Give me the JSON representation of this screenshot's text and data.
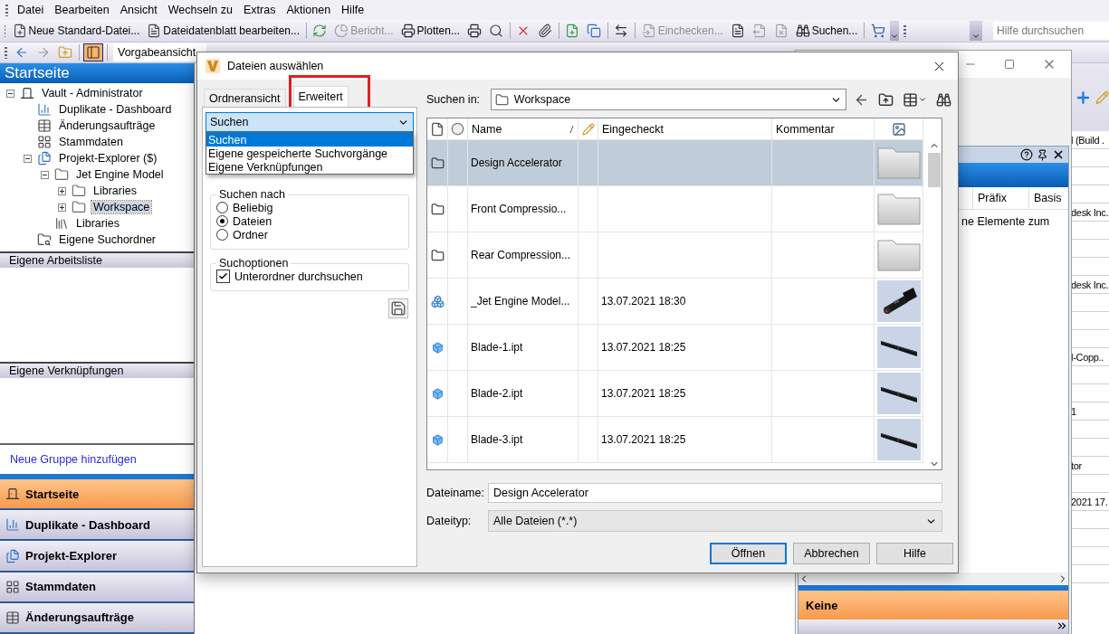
{
  "menu": [
    "Datei",
    "Bearbeiten",
    "Ansicht",
    "Wechseln zu",
    "Extras",
    "Aktionen",
    "Hilfe"
  ],
  "toolbar": [
    {
      "kind": "new-file",
      "label": "Neue Standard-Datei...",
      "disabled": false
    },
    {
      "kind": "datasheet",
      "label": "Dateidatenblatt bearbeiten...",
      "disabled": false
    },
    {
      "kind": "separator"
    },
    {
      "kind": "refresh",
      "disabled": false
    },
    {
      "kind": "report",
      "label": "Bericht...",
      "disabled": true
    },
    {
      "kind": "plot",
      "label": "Plotten...",
      "disabled": false
    },
    {
      "kind": "print",
      "disabled": false
    },
    {
      "kind": "preview",
      "disabled": false
    },
    {
      "kind": "separator"
    },
    {
      "kind": "delete",
      "disabled": false
    },
    {
      "kind": "attach",
      "disabled": false
    },
    {
      "kind": "separator"
    },
    {
      "kind": "add-file",
      "disabled": false
    },
    {
      "kind": "copy",
      "disabled": false
    },
    {
      "kind": "separator"
    },
    {
      "kind": "move",
      "disabled": false
    },
    {
      "kind": "separator"
    },
    {
      "kind": "checkin",
      "label": "Einchecken...",
      "disabled": true
    },
    {
      "kind": "doc",
      "disabled": false
    },
    {
      "kind": "checkout",
      "disabled": true
    },
    {
      "kind": "undo",
      "disabled": true
    },
    {
      "kind": "find",
      "label": "Suchen...",
      "disabled": false
    },
    {
      "kind": "separator"
    },
    {
      "kind": "cart",
      "disabled": false
    }
  ],
  "help_search": {
    "placeholder": "Hilfe durchsuchen"
  },
  "nav_toolbar": [
    {
      "kind": "back",
      "disabled": false,
      "on": false
    },
    {
      "kind": "forward",
      "disabled": true,
      "on": false
    },
    {
      "kind": "up",
      "disabled": false,
      "on": false
    },
    {
      "kind": "layout",
      "disabled": false,
      "on": true
    }
  ],
  "view_field": {
    "value": "Vorgabeansicht"
  },
  "sidebar": {
    "title": "Startseite",
    "tree": [
      {
        "label": "Vault - Administrator",
        "kind": "vault",
        "expanded": true,
        "selected": false,
        "children": [
          {
            "label": "Duplikate - Dashboard",
            "kind": "dashboard",
            "selected": false
          },
          {
            "label": "Änderungsaufträge",
            "kind": "orders",
            "selected": false
          },
          {
            "label": "Stammdaten",
            "kind": "masterdata",
            "selected": false
          },
          {
            "label": "Projekt-Explorer ($)",
            "kind": "explorer",
            "expanded": true,
            "selected": false,
            "children": [
              {
                "label": "Jet Engine Model",
                "kind": "folder",
                "expanded": true,
                "selected": false,
                "children": [
                  {
                    "label": "Libraries",
                    "kind": "folder",
                    "expanded": false,
                    "selected": false
                  },
                  {
                    "label": "Workspace",
                    "kind": "folder",
                    "expanded": false,
                    "selected": true
                  }
                ]
              },
              {
                "label": "Libraries",
                "kind": "library",
                "selected": false
              }
            ]
          },
          {
            "label": "Eigene Suchordner",
            "kind": "search-folder",
            "selected": false
          }
        ]
      }
    ],
    "sections": [
      {
        "title": "Eigene Arbeitsliste"
      },
      {
        "title": "Eigene Verknüpfungen"
      }
    ],
    "add_group_link": "Neue Gruppe hinzufügen",
    "nav_buttons": [
      {
        "label": "Startseite",
        "kind": "vault",
        "selected": true
      },
      {
        "label": "Duplikate - Dashboard",
        "kind": "dashboard",
        "selected": false
      },
      {
        "label": "Projekt-Explorer",
        "kind": "explorer",
        "selected": false
      },
      {
        "label": "Stammdaten",
        "kind": "masterdata",
        "selected": false
      },
      {
        "label": "Änderungsaufträge",
        "kind": "orders",
        "selected": false
      }
    ]
  },
  "background_panel": {
    "columns": [
      "Präfix",
      "Basis"
    ],
    "message": "ne Elemente zum",
    "footer_button": "Keine"
  },
  "background_table": {
    "rows": [
      {
        "column_1": "l (Build ."
      },
      {},
      {},
      {},
      {
        "column_1": "desk Inc."
      },
      {},
      {},
      {},
      {
        "column_1": "desk Inc."
      },
      {},
      {},
      {},
      {
        "column_1": "l-Copp.."
      },
      {},
      {},
      {
        "column_1": "1"
      },
      {},
      {},
      {
        "column_1": "tor"
      },
      {},
      {
        "column_1": "2021 17."
      },
      {},
      {},
      {},
      {}
    ]
  },
  "dialog": {
    "title": "Dateien auswählen",
    "tabs": [
      {
        "label": "Ordneransicht",
        "selected": false,
        "highlighted": false
      },
      {
        "label": "Erweitert",
        "selected": true,
        "highlighted": true
      }
    ],
    "search_mode": {
      "value": "Suchen",
      "expanded": true,
      "options": [
        {
          "label": "Suchen",
          "selected": true
        },
        {
          "label": "Eigene gespeicherte Suchvorgänge",
          "selected": false
        },
        {
          "label": "Eigene Verknüpfungen",
          "selected": false
        }
      ]
    },
    "search_for": {
      "title": "Suchen nach",
      "options": [
        {
          "label": "Beliebig",
          "selected": false
        },
        {
          "label": "Dateien",
          "selected": true
        },
        {
          "label": "Ordner",
          "selected": false
        }
      ]
    },
    "search_options": {
      "title": "Suchoptionen",
      "checkbox": {
        "label": "Unterordner durchsuchen",
        "checked": true
      }
    },
    "look_in": {
      "label": "Suchen in:",
      "value": "Workspace"
    },
    "files": {
      "columns": [
        {
          "kind": "file-icon",
          "sorted": false
        },
        {
          "kind": "status-icon",
          "sorted": false
        },
        {
          "kind": "text",
          "label": "Name",
          "sorted": true
        },
        {
          "kind": "edit-icon",
          "sorted": false
        },
        {
          "kind": "text",
          "label": "Eingecheckt",
          "sorted": false
        },
        {
          "kind": "text",
          "label": "Kommentar",
          "sorted": false
        },
        {
          "kind": "thumbnail-icon",
          "sorted": false
        }
      ],
      "rows": [
        {
          "kind": "folder",
          "name": "Design Accelerator",
          "selected": true
        },
        {
          "kind": "folder",
          "name": "Front Compressio...",
          "selected": false
        },
        {
          "kind": "folder",
          "name": "Rear Compression...",
          "selected": false
        },
        {
          "kind": "assembly",
          "name": "_Jet Engine Model...",
          "checked_in": "13.07.2021 18:30",
          "selected": false
        },
        {
          "kind": "part",
          "name": "Blade-1.ipt",
          "checked_in": "13.07.2021 18:25",
          "selected": false
        },
        {
          "kind": "part",
          "name": "Blade-2.ipt",
          "checked_in": "13.07.2021 18:25",
          "selected": false
        },
        {
          "kind": "part",
          "name": "Blade-3.ipt",
          "checked_in": "13.07.2021 18:25",
          "selected": false
        }
      ]
    },
    "file_name": {
      "label": "Dateiname:",
      "value": "Design Accelerator"
    },
    "file_type": {
      "label": "Dateityp:",
      "value": "Alle Dateien (*.*)"
    },
    "buttons": [
      {
        "label": "Öffnen",
        "default": true
      },
      {
        "label": "Abbrechen",
        "default": false
      },
      {
        "label": "Hilfe",
        "default": false
      }
    ]
  }
}
